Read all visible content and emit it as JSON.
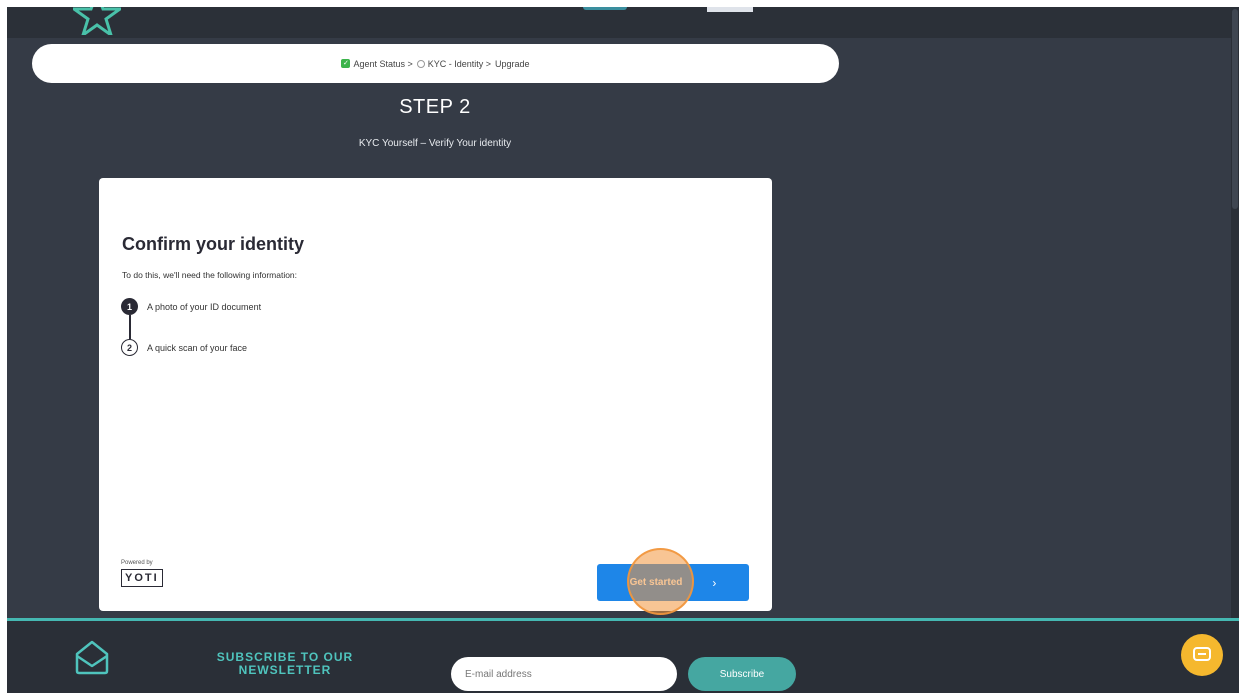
{
  "breadcrumb": {
    "items": [
      {
        "label": "Agent Status >",
        "state": "done"
      },
      {
        "label": "KYC - Identity >",
        "state": "pending"
      },
      {
        "label": "Upgrade",
        "state": "none"
      }
    ]
  },
  "step": {
    "title": "STEP 2",
    "subtitle": "KYC Yourself – Verify Your identity"
  },
  "card": {
    "title": "Confirm your identity",
    "description": "To do this, we'll need the following information:",
    "requirements": [
      {
        "number": "1",
        "label": "A photo of your ID document"
      },
      {
        "number": "2",
        "label": "A quick scan of your face"
      }
    ],
    "powered_by": "Powered by",
    "brand": "YOTI",
    "cta_label": "Get started",
    "cta_chevron": "›"
  },
  "footer": {
    "newsletter_title": "SUBSCRIBE TO OUR NEWSLETTER",
    "email_placeholder": "E-mail address",
    "subscribe_label": "Subscribe"
  },
  "colors": {
    "page_bg": "#353b46",
    "accent_teal": "#45b8b2",
    "cta_blue": "#1e86e8",
    "chat_yellow": "#f5b82e",
    "check_green": "#3cb44b"
  }
}
